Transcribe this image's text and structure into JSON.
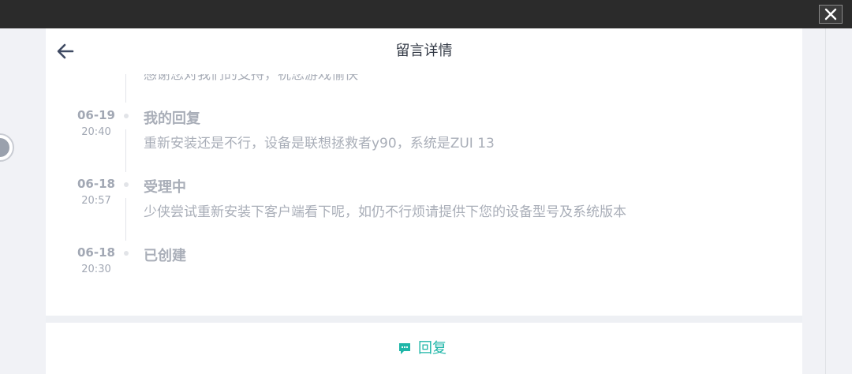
{
  "window": {
    "close_icon": "close-icon"
  },
  "header": {
    "title": "留言详情",
    "back_icon": "arrow-left-icon"
  },
  "timeline": [
    {
      "date": "",
      "time": "",
      "title": "",
      "text": "感谢您对我们的支持，祝您游戏愉快"
    },
    {
      "date": "06-19",
      "time": "20:40",
      "title": "我的回复",
      "text": "重新安装还是不行，设备是联想拯救者y90，系统是ZUI 13"
    },
    {
      "date": "06-18",
      "time": "20:57",
      "title": "受理中",
      "text": "少侠尝试重新安装下客户端看下呢，如仍不行烦请提供下您的设备型号及系统版本"
    },
    {
      "date": "06-18",
      "time": "20:30",
      "title": "已创建",
      "text": ""
    }
  ],
  "footer": {
    "reply_label": "回复",
    "reply_icon": "chat-bubble-icon"
  },
  "colors": {
    "accent": "#1fb6a8",
    "topbar": "#2b2b2b",
    "muted_text": "#a9aeb8"
  }
}
